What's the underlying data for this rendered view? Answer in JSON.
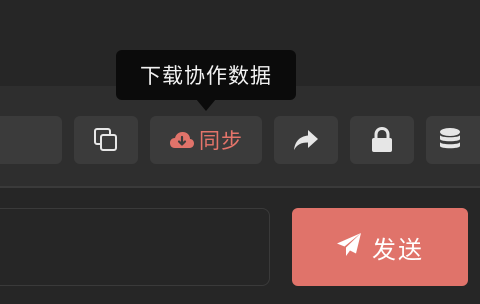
{
  "tooltip": {
    "text": "下载协作数据"
  },
  "toolbar": {
    "sync_label": "同步",
    "buttons": [
      {
        "icon": "input-field-partial"
      },
      {
        "icon": "copy-icon"
      },
      {
        "icon": "cloud-download-icon"
      },
      {
        "icon": "share-icon"
      },
      {
        "icon": "lock-icon"
      },
      {
        "icon": "database-icon"
      }
    ]
  },
  "composer": {
    "input_value": "",
    "send_label": "发送",
    "send_icon": "paper-plane-icon"
  },
  "colors": {
    "background": "#262626",
    "button": "#3b3b3b",
    "accent": "#e0736a",
    "tooltip": "#0b0b0b"
  }
}
